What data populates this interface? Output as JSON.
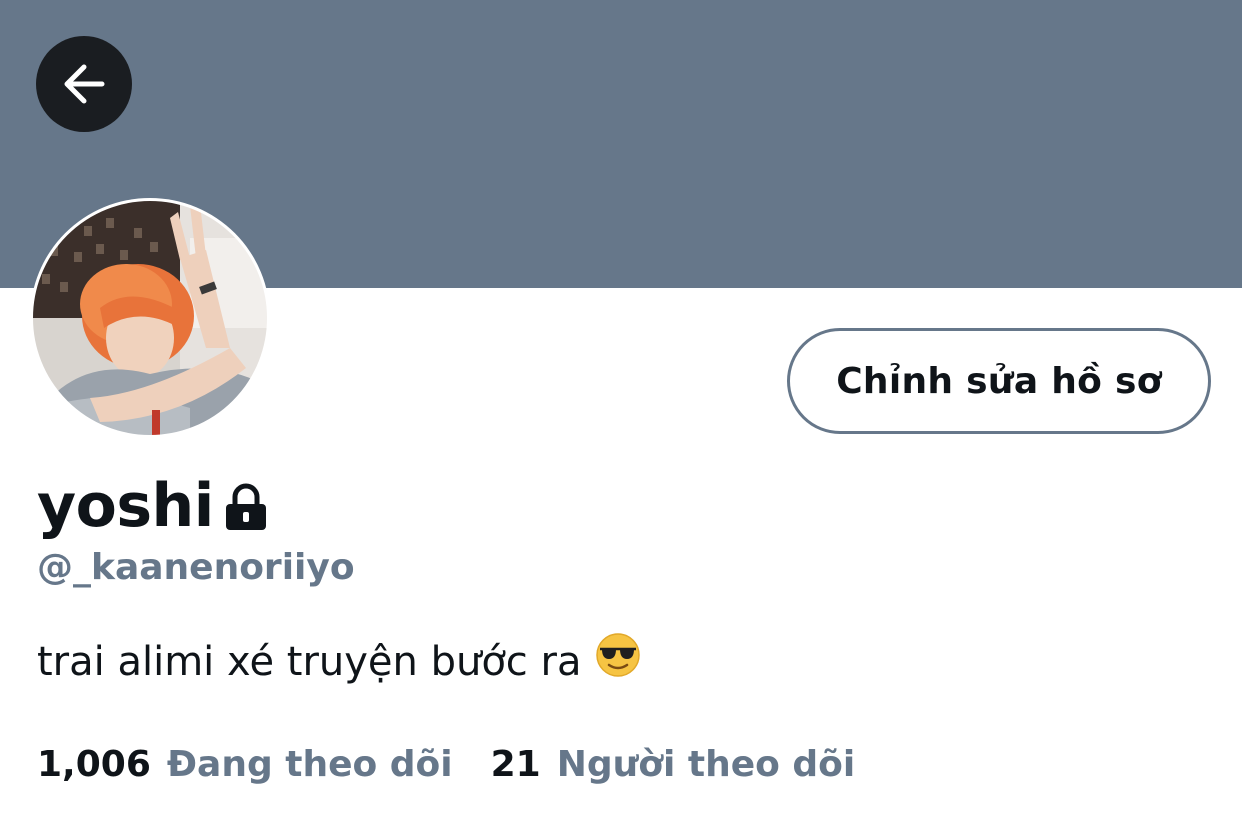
{
  "profile": {
    "display_name": "yoshi",
    "handle": "@_kaanenoriiyo",
    "bio": "trai alimi xé truyện bước ra",
    "bio_emoji": "smiling-face-with-sunglasses"
  },
  "actions": {
    "edit_profile_label": "Chỉnh sửa hồ sơ"
  },
  "stats": {
    "following_count": "1,006",
    "following_label": "Đang theo dõi",
    "followers_count": "21",
    "followers_label": "Người theo dõi"
  },
  "icons": {
    "back": "arrow-left-icon",
    "lock": "lock-icon"
  },
  "colors": {
    "banner": "#66778a",
    "text_primary": "#0f1419",
    "text_secondary": "#66778a",
    "back_button_bg": "#1a1d21"
  }
}
